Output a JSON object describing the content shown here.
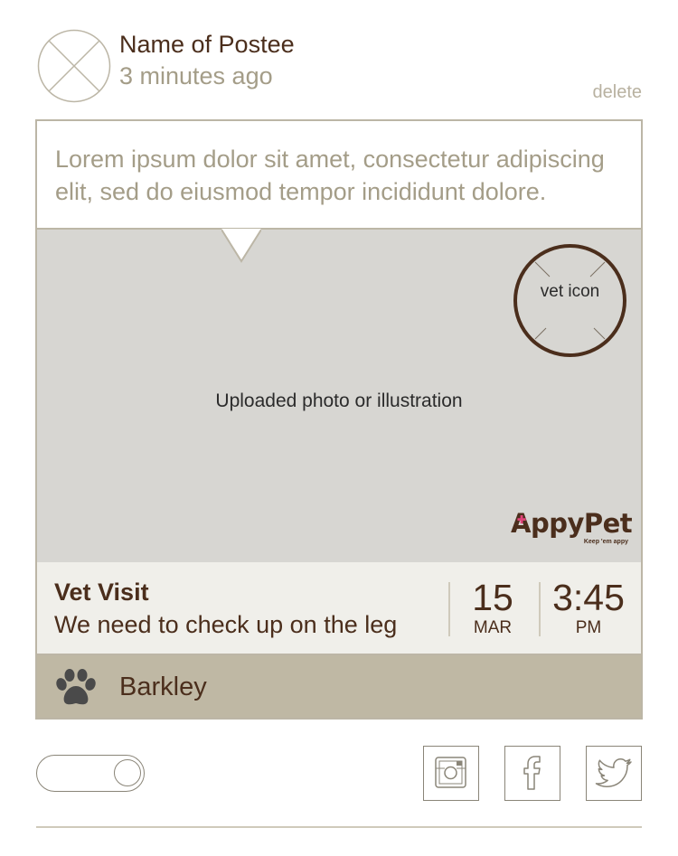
{
  "post": {
    "poster_name": "Name of Postee",
    "time_ago": "3 minutes ago",
    "delete_label": "delete",
    "caption": "Lorem ipsum dolor sit amet, consectetur adipiscing elit, sed do eiusmod tempor incididunt dolore."
  },
  "media": {
    "placeholder_label": "Uploaded photo or illustration",
    "vet_icon_text": "vet icon",
    "brand": {
      "name": "AppyPet",
      "tagline": "Keep 'em appy"
    }
  },
  "event": {
    "title": "Vet Visit",
    "description": "We need to check up on the leg",
    "day": "15",
    "month": "MAR",
    "time": "3:45",
    "ampm": "PM"
  },
  "pet": {
    "name": "Barkley",
    "icon": "paw-icon"
  },
  "actions": {
    "toggle_state": "on",
    "share_icons": [
      "instagram-icon",
      "facebook-icon",
      "twitter-icon"
    ]
  },
  "colors": {
    "brand_brown": "#4b2e1c",
    "muted_text": "#a49d88",
    "photo_bg": "#d7d6d2",
    "pet_bar_bg": "#bfb8a4",
    "event_bar_bg": "#f0efea"
  }
}
